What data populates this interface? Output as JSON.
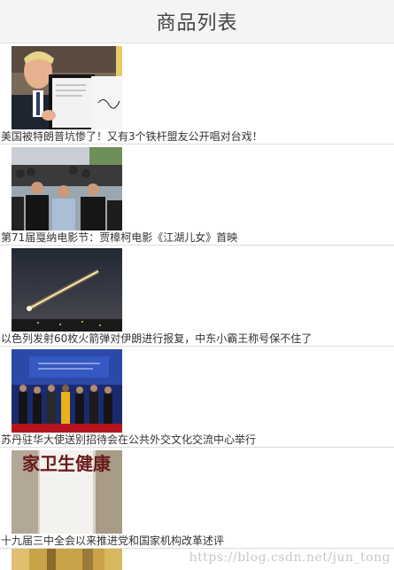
{
  "header": {
    "title": "商品列表"
  },
  "items": [
    {
      "title": "美国被特朗普坑惨了！又有3个铁杆盟友公开唱对台戏！",
      "image": "president-signing-photo"
    },
    {
      "title": "第71届戛纳电影节：贾樟柯电影《江湖儿女》首映",
      "image": "red-carpet-photo"
    },
    {
      "title": "以色列发射60枚火箭弹对伊朗进行报复，中东小霸王称号保不住了",
      "image": "night-rocket-photo"
    },
    {
      "title": "苏丹驻华大使送别招待会在公共外交文化交流中心举行",
      "image": "reception-stage-photo"
    },
    {
      "title": "十九届三中全会以来推进党和国家机构改革述评",
      "image": "sign-plaque-photo",
      "image_text": "家卫生健康"
    },
    {
      "image": "gold-building-photo"
    }
  ],
  "watermark": "https://blog.csdn.net/jun_tong"
}
